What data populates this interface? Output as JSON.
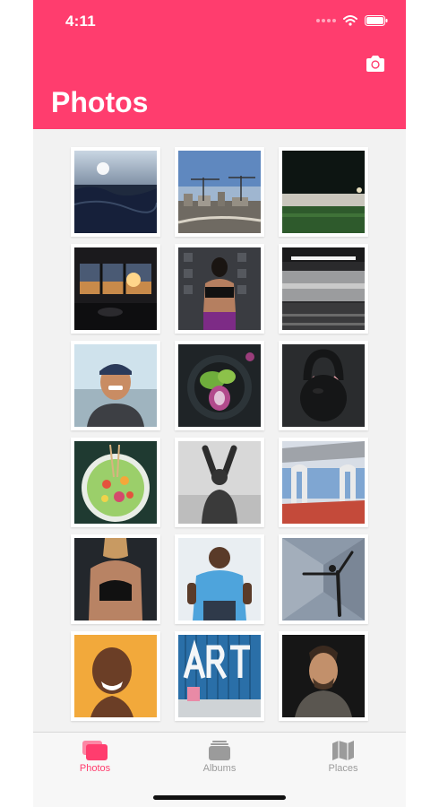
{
  "status_bar": {
    "time": "4:11"
  },
  "header": {
    "title": "Photos",
    "camera_icon": "camera-icon"
  },
  "colors": {
    "accent": "#ff3d6e",
    "tab_active": "#ff3d6e",
    "tab_inactive": "#9b9b9b"
  },
  "photos": [
    {
      "subject": "ocean-waves-sunrise"
    },
    {
      "subject": "city-cranes-skyline"
    },
    {
      "subject": "night-sports-field"
    },
    {
      "subject": "restaurant-window-sunset"
    },
    {
      "subject": "woman-sports-bra-back"
    },
    {
      "subject": "subway-station-platform"
    },
    {
      "subject": "smiling-man-cap"
    },
    {
      "subject": "bowl-of-greens"
    },
    {
      "subject": "kettlebell"
    },
    {
      "subject": "salad-bowl"
    },
    {
      "subject": "man-stretching-bw"
    },
    {
      "subject": "modern-bridge"
    },
    {
      "subject": "woman-back-muscles"
    },
    {
      "subject": "man-blue-tshirt"
    },
    {
      "subject": "yoga-pose"
    },
    {
      "subject": "laughing-woman-yellow"
    },
    {
      "subject": "art-container-wall"
    },
    {
      "subject": "man-portrait-dark"
    }
  ],
  "tabs": [
    {
      "label": "Photos",
      "icon": "photos-icon",
      "active": true
    },
    {
      "label": "Albums",
      "icon": "albums-icon",
      "active": false
    },
    {
      "label": "Places",
      "icon": "map-icon",
      "active": false
    }
  ]
}
